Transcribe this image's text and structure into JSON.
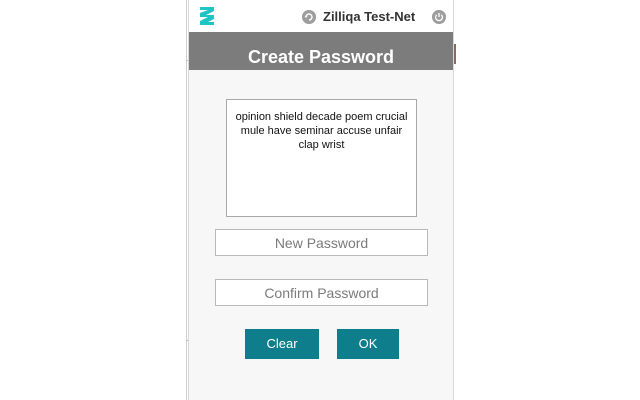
{
  "header": {
    "network_name": "Zilliqa Test-Net",
    "icons": [
      "zilliqa-logo",
      "refresh-icon",
      "power-icon"
    ]
  },
  "page": {
    "title": "Create Password"
  },
  "seed": {
    "text": "opinion shield decade poem crucial mule have seminar accuse unfair clap wrist"
  },
  "form": {
    "new_password_placeholder": "New Password",
    "confirm_password_placeholder": "Confirm Password"
  },
  "buttons": {
    "clear_label": "Clear",
    "ok_label": "OK"
  },
  "colors": {
    "accent": "#0e7d8c",
    "logo": "#1fc4c4",
    "header_band": "#7c7c7c",
    "icon_gray": "#9e9e9e"
  }
}
